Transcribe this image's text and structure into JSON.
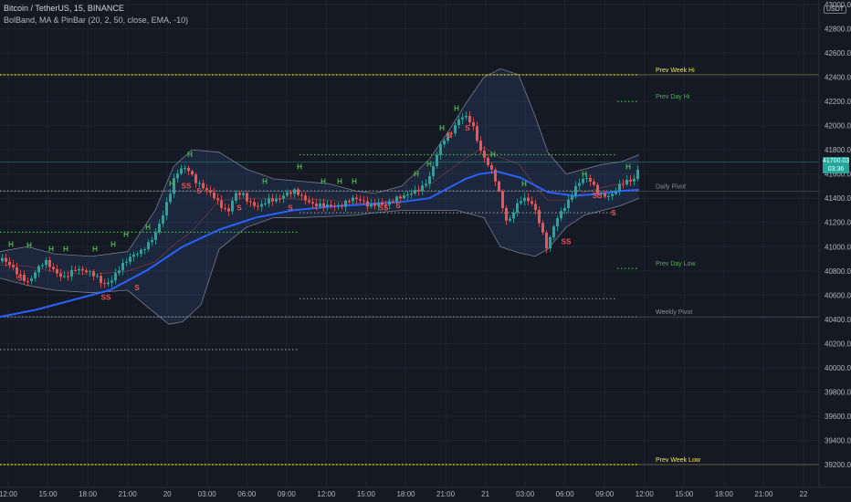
{
  "header": {
    "symbol_line": "Bitcoin / TetherUS, 15, BINANCE",
    "indicator_line": "BolBand, MA & PinBar (20, 2, 50, close, EMA, -10)"
  },
  "price_axis": {
    "unit": "USDT",
    "ticks": [
      {
        "value": 43000,
        "label": "43000.00"
      },
      {
        "value": 42800,
        "label": "42800.00"
      },
      {
        "value": 42600,
        "label": "42600.00"
      },
      {
        "value": 42400,
        "label": "42400.00"
      },
      {
        "value": 42200,
        "label": "42200.00"
      },
      {
        "value": 42000,
        "label": "42000.00"
      },
      {
        "value": 41800,
        "label": "41800.00"
      },
      {
        "value": 41600,
        "label": "41600.00"
      },
      {
        "value": 41400,
        "label": "41400.00"
      },
      {
        "value": 41200,
        "label": "41200.00"
      },
      {
        "value": 41000,
        "label": "41000.00"
      },
      {
        "value": 40800,
        "label": "40800.00"
      },
      {
        "value": 40600,
        "label": "40600.00"
      },
      {
        "value": 40400,
        "label": "40400.00"
      },
      {
        "value": 40200,
        "label": "40200.00"
      },
      {
        "value": 40000,
        "label": "40000.00"
      },
      {
        "value": 39800,
        "label": "39800.00"
      },
      {
        "value": 39600,
        "label": "39600.00"
      },
      {
        "value": 39400,
        "label": "39400.00"
      },
      {
        "value": 39200,
        "label": "39200.00"
      }
    ],
    "last_price": 41700.03,
    "last_price_label": "41700.03",
    "countdown": "03:36",
    "tag_color": "#26a69a"
  },
  "time_axis": {
    "labels": [
      "12:00",
      "15:00",
      "18:00",
      "21:00",
      "20",
      "03:00",
      "06:00",
      "09:00",
      "12:00",
      "15:00",
      "18:00",
      "21:00",
      "21",
      "03:00",
      "06:00",
      "09:00",
      "12:00",
      "15:00",
      "18:00",
      "21:00",
      "22"
    ]
  },
  "colors": {
    "background": "#151924",
    "grid": "#1f2331",
    "up": "#26a69a",
    "down": "#ef5350",
    "ema": "#2962ff",
    "band_fill": "rgba(66,120,190,0.16)",
    "band_line": "#787b86",
    "yellow_level": "#f5e93b",
    "green_level": "#4caf50",
    "grey_level": "#8a8d96",
    "pin_high": "#4caf50",
    "pin_low": "#ef5350"
  },
  "chart_data": {
    "type": "candlestick",
    "symbol": "Bitcoin / TetherUS",
    "interval": "15",
    "exchange": "BINANCE",
    "indicator": "BolBand, MA & PinBar (20, 2, 50, close, EMA, -10)",
    "ylim": [
      39080,
      43020
    ],
    "price_path": [
      [
        0,
        40880
      ],
      [
        10,
        40840
      ],
      [
        20,
        40780
      ],
      [
        30,
        40720
      ],
      [
        38,
        40800
      ],
      [
        48,
        40860
      ],
      [
        58,
        40790
      ],
      [
        68,
        40760
      ],
      [
        80,
        40830
      ],
      [
        92,
        40780
      ],
      [
        104,
        40740
      ],
      [
        112,
        40690
      ],
      [
        120,
        40740
      ],
      [
        130,
        40840
      ],
      [
        142,
        40900
      ],
      [
        152,
        40940
      ],
      [
        160,
        41020
      ],
      [
        168,
        41120
      ],
      [
        176,
        41260
      ],
      [
        184,
        41420
      ],
      [
        190,
        41560
      ],
      [
        196,
        41620
      ],
      [
        204,
        41640
      ],
      [
        212,
        41560
      ],
      [
        220,
        41520
      ],
      [
        230,
        41440
      ],
      [
        240,
        41320
      ],
      [
        248,
        41260
      ],
      [
        256,
        41440
      ],
      [
        264,
        41460
      ],
      [
        272,
        41380
      ],
      [
        282,
        41320
      ],
      [
        292,
        41360
      ],
      [
        302,
        41380
      ],
      [
        312,
        41460
      ],
      [
        322,
        41480
      ],
      [
        332,
        41380
      ],
      [
        342,
        41320
      ],
      [
        352,
        41340
      ],
      [
        362,
        41360
      ],
      [
        372,
        41350
      ],
      [
        382,
        41380
      ],
      [
        392,
        41370
      ],
      [
        402,
        41340
      ],
      [
        412,
        41380
      ],
      [
        422,
        41360
      ],
      [
        432,
        41380
      ],
      [
        442,
        41400
      ],
      [
        452,
        41460
      ],
      [
        462,
        41520
      ],
      [
        470,
        41600
      ],
      [
        478,
        41780
      ],
      [
        486,
        41880
      ],
      [
        494,
        41940
      ],
      [
        500,
        42050
      ],
      [
        506,
        42100
      ],
      [
        512,
        42080
      ],
      [
        518,
        41980
      ],
      [
        524,
        41800
      ],
      [
        530,
        41700
      ],
      [
        536,
        41620
      ],
      [
        542,
        41520
      ],
      [
        548,
        41360
      ],
      [
        554,
        41200
      ],
      [
        560,
        41300
      ],
      [
        568,
        41400
      ],
      [
        576,
        41380
      ],
      [
        584,
        41300
      ],
      [
        592,
        41120
      ],
      [
        598,
        40980
      ],
      [
        604,
        41180
      ],
      [
        612,
        41300
      ],
      [
        620,
        41360
      ],
      [
        628,
        41460
      ],
      [
        636,
        41540
      ],
      [
        644,
        41560
      ],
      [
        652,
        41480
      ],
      [
        660,
        41440
      ],
      [
        668,
        41420
      ],
      [
        676,
        41480
      ],
      [
        684,
        41520
      ],
      [
        692,
        41540
      ],
      [
        700,
        41700
      ]
    ],
    "ema_path": [
      [
        0,
        40420
      ],
      [
        40,
        40480
      ],
      [
        80,
        40560
      ],
      [
        120,
        40640
      ],
      [
        160,
        40800
      ],
      [
        200,
        41000
      ],
      [
        240,
        41140
      ],
      [
        280,
        41240
      ],
      [
        320,
        41300
      ],
      [
        360,
        41330
      ],
      [
        400,
        41350
      ],
      [
        440,
        41370
      ],
      [
        470,
        41400
      ],
      [
        490,
        41480
      ],
      [
        510,
        41560
      ],
      [
        525,
        41600
      ],
      [
        545,
        41620
      ],
      [
        570,
        41570
      ],
      [
        600,
        41450
      ],
      [
        630,
        41420
      ],
      [
        660,
        41440
      ],
      [
        680,
        41460
      ],
      [
        700,
        41470
      ]
    ],
    "band_upper": [
      [
        0,
        40960
      ],
      [
        30,
        41000
      ],
      [
        60,
        40940
      ],
      [
        100,
        40920
      ],
      [
        140,
        40960
      ],
      [
        170,
        41300
      ],
      [
        190,
        41660
      ],
      [
        210,
        41800
      ],
      [
        240,
        41780
      ],
      [
        270,
        41640
      ],
      [
        300,
        41560
      ],
      [
        330,
        41540
      ],
      [
        360,
        41520
      ],
      [
        390,
        41460
      ],
      [
        410,
        41440
      ],
      [
        440,
        41500
      ],
      [
        470,
        41720
      ],
      [
        490,
        41940
      ],
      [
        510,
        42180
      ],
      [
        530,
        42400
      ],
      [
        548,
        42470
      ],
      [
        568,
        42420
      ],
      [
        586,
        42080
      ],
      [
        600,
        41780
      ],
      [
        620,
        41600
      ],
      [
        640,
        41640
      ],
      [
        660,
        41680
      ],
      [
        680,
        41700
      ],
      [
        700,
        41760
      ]
    ],
    "band_lower": [
      [
        0,
        40740
      ],
      [
        30,
        40680
      ],
      [
        60,
        40640
      ],
      [
        100,
        40620
      ],
      [
        140,
        40640
      ],
      [
        165,
        40480
      ],
      [
        185,
        40360
      ],
      [
        200,
        40380
      ],
      [
        220,
        40520
      ],
      [
        240,
        40980
      ],
      [
        270,
        41160
      ],
      [
        300,
        41240
      ],
      [
        330,
        41240
      ],
      [
        360,
        41250
      ],
      [
        390,
        41260
      ],
      [
        410,
        41280
      ],
      [
        440,
        41300
      ],
      [
        470,
        41300
      ],
      [
        500,
        41300
      ],
      [
        530,
        41240
      ],
      [
        548,
        41000
      ],
      [
        568,
        40950
      ],
      [
        586,
        40920
      ],
      [
        600,
        40980
      ],
      [
        620,
        41160
      ],
      [
        640,
        41260
      ],
      [
        660,
        41300
      ],
      [
        680,
        41340
      ],
      [
        700,
        41400
      ]
    ],
    "levels": [
      {
        "label": "Prev Week Hi",
        "value": 42420,
        "from": 0,
        "to": 700,
        "color_key": "yellow_level",
        "text_color": "#f5e93b"
      },
      {
        "label": "Prev Day Hi",
        "value": 42200,
        "from": 676,
        "to": 700,
        "color_key": "green_level",
        "text_color": "#4caf50"
      },
      {
        "label": "",
        "value": 41760,
        "from": 328,
        "to": 676,
        "color_key": "green_level",
        "text_color": ""
      },
      {
        "label": "Daily Pivot",
        "value": 41460,
        "from": 0,
        "to": 700,
        "color_key": "grey_level",
        "text_color": "#8a8d96"
      },
      {
        "label": "",
        "value": 41280,
        "from": 328,
        "to": 676,
        "color_key": "grey_level",
        "text_color": ""
      },
      {
        "label": "",
        "value": 41120,
        "from": 0,
        "to": 328,
        "color_key": "green_level",
        "text_color": ""
      },
      {
        "label": "Prev Day Low",
        "value": 40820,
        "from": 676,
        "to": 700,
        "color_key": "green_level",
        "text_color": "#4caf50"
      },
      {
        "label": "",
        "value": 40570,
        "from": 328,
        "to": 676,
        "color_key": "grey_level",
        "text_color": ""
      },
      {
        "label": "Weekly Pivot",
        "value": 40420,
        "from": 0,
        "to": 700,
        "color_key": "grey_level",
        "text_color": "#8a8d96"
      },
      {
        "label": "",
        "value": 40150,
        "from": 0,
        "to": 328,
        "color_key": "grey_level",
        "text_color": ""
      },
      {
        "label": "Prev Week Low",
        "value": 39200,
        "from": 0,
        "to": 700,
        "color_key": "yellow_level",
        "text_color": "#f5e93b"
      }
    ],
    "pin_bars": [
      {
        "x": 12,
        "value": 41000,
        "label": "H",
        "kind": "high"
      },
      {
        "x": 22,
        "value": 40720,
        "label": "S",
        "kind": "low"
      },
      {
        "x": 32,
        "value": 40990,
        "label": "H",
        "kind": "high"
      },
      {
        "x": 56,
        "value": 40960,
        "label": "H",
        "kind": "high"
      },
      {
        "x": 72,
        "value": 40960,
        "label": "H",
        "kind": "high"
      },
      {
        "x": 104,
        "value": 40960,
        "label": "H",
        "kind": "high"
      },
      {
        "x": 116,
        "value": 40560,
        "label": "SS",
        "kind": "low"
      },
      {
        "x": 124,
        "value": 41000,
        "label": "H",
        "kind": "high"
      },
      {
        "x": 138,
        "value": 41080,
        "label": "H",
        "kind": "high"
      },
      {
        "x": 150,
        "value": 40640,
        "label": "S",
        "kind": "low"
      },
      {
        "x": 162,
        "value": 41140,
        "label": "H",
        "kind": "high"
      },
      {
        "x": 188,
        "value": 41500,
        "label": "H",
        "kind": "high"
      },
      {
        "x": 204,
        "value": 41480,
        "label": "SS",
        "kind": "low"
      },
      {
        "x": 218,
        "value": 41440,
        "label": "S",
        "kind": "low"
      },
      {
        "x": 208,
        "value": 41740,
        "label": "H",
        "kind": "high"
      },
      {
        "x": 262,
        "value": 41300,
        "label": "S",
        "kind": "low"
      },
      {
        "x": 290,
        "value": 41520,
        "label": "H",
        "kind": "high"
      },
      {
        "x": 318,
        "value": 41300,
        "label": "S",
        "kind": "low"
      },
      {
        "x": 328,
        "value": 41640,
        "label": "H",
        "kind": "high"
      },
      {
        "x": 354,
        "value": 41520,
        "label": "H",
        "kind": "high"
      },
      {
        "x": 372,
        "value": 41520,
        "label": "H",
        "kind": "high"
      },
      {
        "x": 388,
        "value": 41520,
        "label": "H",
        "kind": "high"
      },
      {
        "x": 420,
        "value": 41300,
        "label": "SS",
        "kind": "low"
      },
      {
        "x": 436,
        "value": 41320,
        "label": "S",
        "kind": "low"
      },
      {
        "x": 456,
        "value": 41580,
        "label": "H",
        "kind": "high"
      },
      {
        "x": 470,
        "value": 41660,
        "label": "H",
        "kind": "high"
      },
      {
        "x": 484,
        "value": 41960,
        "label": "H",
        "kind": "high"
      },
      {
        "x": 492,
        "value": 41900,
        "label": "S",
        "kind": "low"
      },
      {
        "x": 500,
        "value": 42120,
        "label": "H",
        "kind": "high"
      },
      {
        "x": 512,
        "value": 41960,
        "label": "S",
        "kind": "low"
      },
      {
        "x": 540,
        "value": 41740,
        "label": "H",
        "kind": "high"
      },
      {
        "x": 574,
        "value": 41500,
        "label": "H",
        "kind": "high"
      },
      {
        "x": 620,
        "value": 41020,
        "label": "SS",
        "kind": "low"
      },
      {
        "x": 640,
        "value": 41580,
        "label": "H",
        "kind": "high"
      },
      {
        "x": 654,
        "value": 41400,
        "label": "SS",
        "kind": "low"
      },
      {
        "x": 672,
        "value": 41260,
        "label": "S",
        "kind": "low"
      },
      {
        "x": 688,
        "value": 41640,
        "label": "H",
        "kind": "high"
      }
    ]
  }
}
